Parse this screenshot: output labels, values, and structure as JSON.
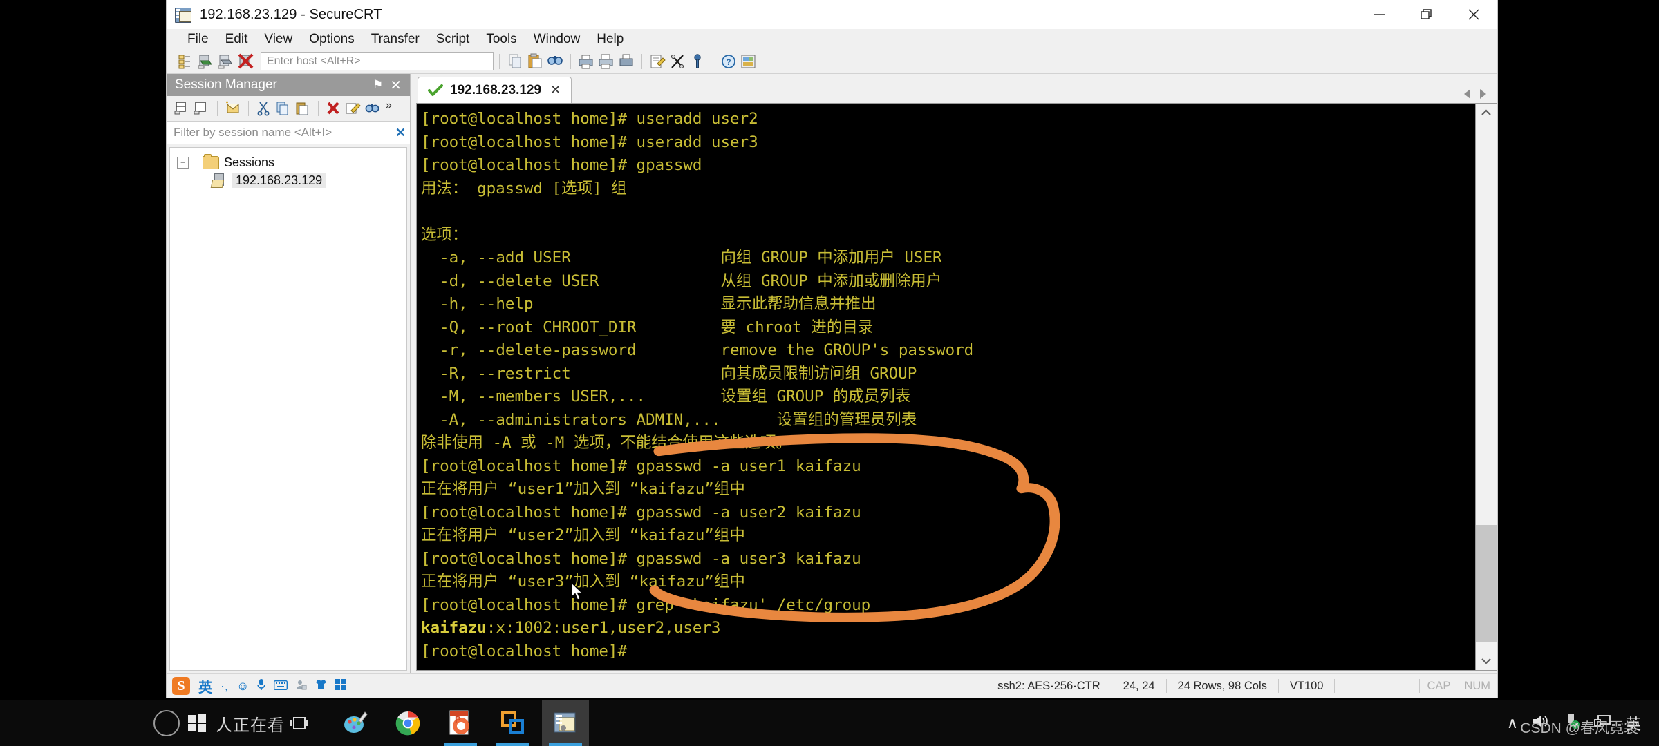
{
  "window": {
    "title": "192.168.23.129 - SecureCRT",
    "icon": "securecrt-icon",
    "minimize": "—",
    "restore": "❐",
    "close": "✕"
  },
  "menubar": {
    "items": [
      "File",
      "Edit",
      "View",
      "Options",
      "Transfer",
      "Script",
      "Tools",
      "Window",
      "Help"
    ]
  },
  "toolbar": {
    "host_placeholder": "Enter host <Alt+R>",
    "icons": [
      "session-manager-icon",
      "connect-icon",
      "connect-sftp-icon",
      "disconnect-icon",
      "copy-icon",
      "paste-icon",
      "find-icon",
      "print-icon",
      "print-selection-icon",
      "print-page-icon",
      "log-session-icon",
      "transfer-icon",
      "key-icon",
      "help-icon",
      "properties-icon"
    ]
  },
  "session_manager": {
    "title": "Session Manager",
    "pin": "⚑",
    "close": "✕",
    "filter_placeholder": "Filter by session name <Alt+I>",
    "filter_clear": "✕",
    "tool_icons": [
      "connect-session-icon",
      "connect-folder-icon",
      "new-session-icon",
      "cut-icon",
      "copy-icon",
      "paste-icon",
      "delete-icon",
      "rename-icon",
      "find-icon",
      "overflow-icon"
    ],
    "tree": {
      "root_label": "Sessions",
      "root_expander": "−",
      "children": [
        {
          "label": "192.168.23.129",
          "selected": true
        }
      ]
    }
  },
  "tabs": {
    "items": [
      {
        "label": "192.168.23.129",
        "status_icon": "connected-check-icon",
        "close": "✕",
        "active": true
      }
    ],
    "scroll_left": "left-arrow-icon",
    "scroll_right": "right-arrow-icon"
  },
  "terminal": {
    "foreground": "#c8bd35",
    "background": "#000000",
    "lines": [
      {
        "text": "[root@localhost home]# useradd user2"
      },
      {
        "text": "[root@localhost home]# useradd user3"
      },
      {
        "text": "[root@localhost home]# gpasswd"
      },
      {
        "text": "用法： gpasswd [选项] 组"
      },
      {
        "text": ""
      },
      {
        "text": "选项："
      },
      {
        "text": "  -a, --add USER                向组 GROUP 中添加用户 USER"
      },
      {
        "text": "  -d, --delete USER             从组 GROUP 中添加或删除用户"
      },
      {
        "text": "  -h, --help                    显示此帮助信息并推出"
      },
      {
        "text": "  -Q, --root CHROOT_DIR         要 chroot 进的目录"
      },
      {
        "text": "  -r, --delete-password         remove the GROUP's password"
      },
      {
        "text": "  -R, --restrict                向其成员限制访问组 GROUP"
      },
      {
        "text": "  -M, --members USER,...        设置组 GROUP 的成员列表"
      },
      {
        "text": "  -A, --administrators ADMIN,...      设置组的管理员列表"
      },
      {
        "text": "除非使用 -A 或 -M 选项，不能结合使用这些选项。"
      },
      {
        "text": "[root@localhost home]# gpasswd -a user1 kaifazu"
      },
      {
        "text": "正在将用户 “user1”加入到 “kaifazu”组中"
      },
      {
        "text": "[root@localhost home]# gpasswd -a user2 kaifazu"
      },
      {
        "text": "正在将用户 “user2”加入到 “kaifazu”组中"
      },
      {
        "text": "[root@localhost home]# gpasswd -a user3 kaifazu"
      },
      {
        "text": "正在将用户 “user3”加入到 “kaifazu”组中"
      },
      {
        "text": "[root@localhost home]# grep 'kaifazu' /etc/group"
      },
      {
        "text": "kaifazu:x:1002:user1,user2,user3",
        "bold_prefix": "kaifazu"
      },
      {
        "text": "[root@localhost home]#"
      }
    ],
    "annotation": {
      "color": "#e8873f",
      "shape": "hand-drawn-circle"
    }
  },
  "statusbar": {
    "ime": {
      "logo": "S",
      "mode": "英",
      "icons": [
        "punctuation-icon",
        "emoji-icon",
        "voice-input-icon",
        "soft-keyboard-icon",
        "user-icon",
        "skin-icon",
        "menu-icon"
      ]
    },
    "cells": [
      "ssh2: AES-256-CTR",
      "24,  24",
      "24 Rows, 98 Cols",
      "VT100",
      ""
    ],
    "cap": "CAP",
    "num": "NUM"
  },
  "taskbar": {
    "start": "windows-logo-icon",
    "search_text": "人正在看",
    "cortana": "cortana-circle-icon",
    "taskview": "task-view-icon",
    "apps": [
      {
        "name": "paint-3d",
        "active": false,
        "running": false
      },
      {
        "name": "google-chrome",
        "active": false,
        "running": false
      },
      {
        "name": "powerpoint",
        "active": false,
        "running": true
      },
      {
        "name": "vmware-workstation",
        "active": false,
        "running": true
      },
      {
        "name": "securecrt",
        "active": true,
        "running": true
      }
    ],
    "tray": {
      "chevron": "∧",
      "volume": "volume-icon",
      "usb": "usb-safely-remove-icon",
      "network": "network-icon",
      "ime": "英"
    }
  },
  "watermark": "CSDN @春风霓裳"
}
